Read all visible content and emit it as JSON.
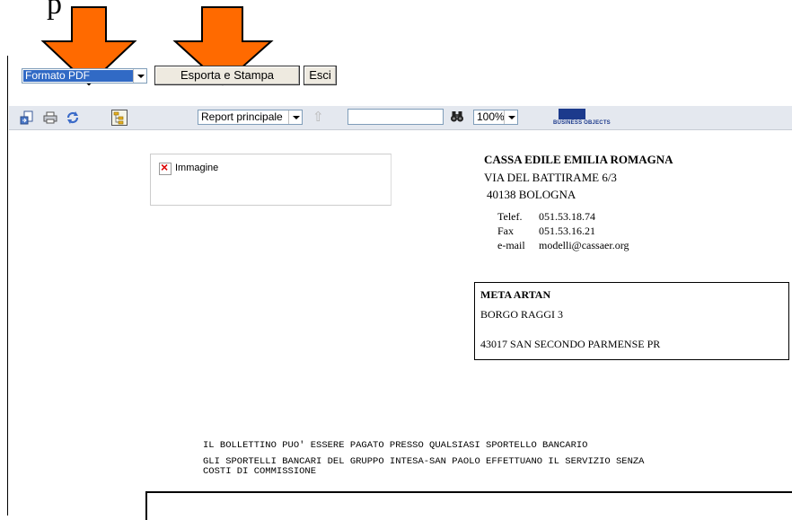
{
  "annotation": {
    "top_text": "p",
    "arrow_color": "#ff6a00"
  },
  "export_bar": {
    "format_selected": "Formato PDF",
    "export_button": "Esporta e Stampa",
    "exit_button": "Esci"
  },
  "toolbar": {
    "icons": [
      "export-icon",
      "print-icon",
      "refresh-icon",
      "group-tree-icon"
    ],
    "report_select": "Report principale",
    "search_value": "",
    "zoom": "100%",
    "logo_text": "BUSINESS OBJECTS"
  },
  "report": {
    "image_placeholder": "Immagine",
    "sender": {
      "name": "CASSA EDILE EMILIA ROMAGNA",
      "address": "VIA DEL BATTIRAME 6/3",
      "city": "40138 BOLOGNA",
      "tel_label": "Telef.",
      "tel": "051.53.18.74",
      "fax_label": "Fax",
      "fax": "051.53.16.21",
      "email_label": "e-mail",
      "email": "modelli@cassaer.org"
    },
    "recipient": {
      "name": "META ARTAN",
      "address": "BORGO RAGGI 3",
      "city": "43017 SAN SECONDO PARMENSE  PR"
    },
    "notice_line1": "IL BOLLETTINO PUO' ESSERE PAGATO PRESSO QUALSIASI SPORTELLO BANCARIO",
    "notice_line2": "GLI SPORTELLI BANCARI DEL GRUPPO INTESA-SAN PAOLO EFFETTUANO IL SERVIZIO SENZA",
    "notice_line3": "COSTI DI COMMISSIONE"
  }
}
